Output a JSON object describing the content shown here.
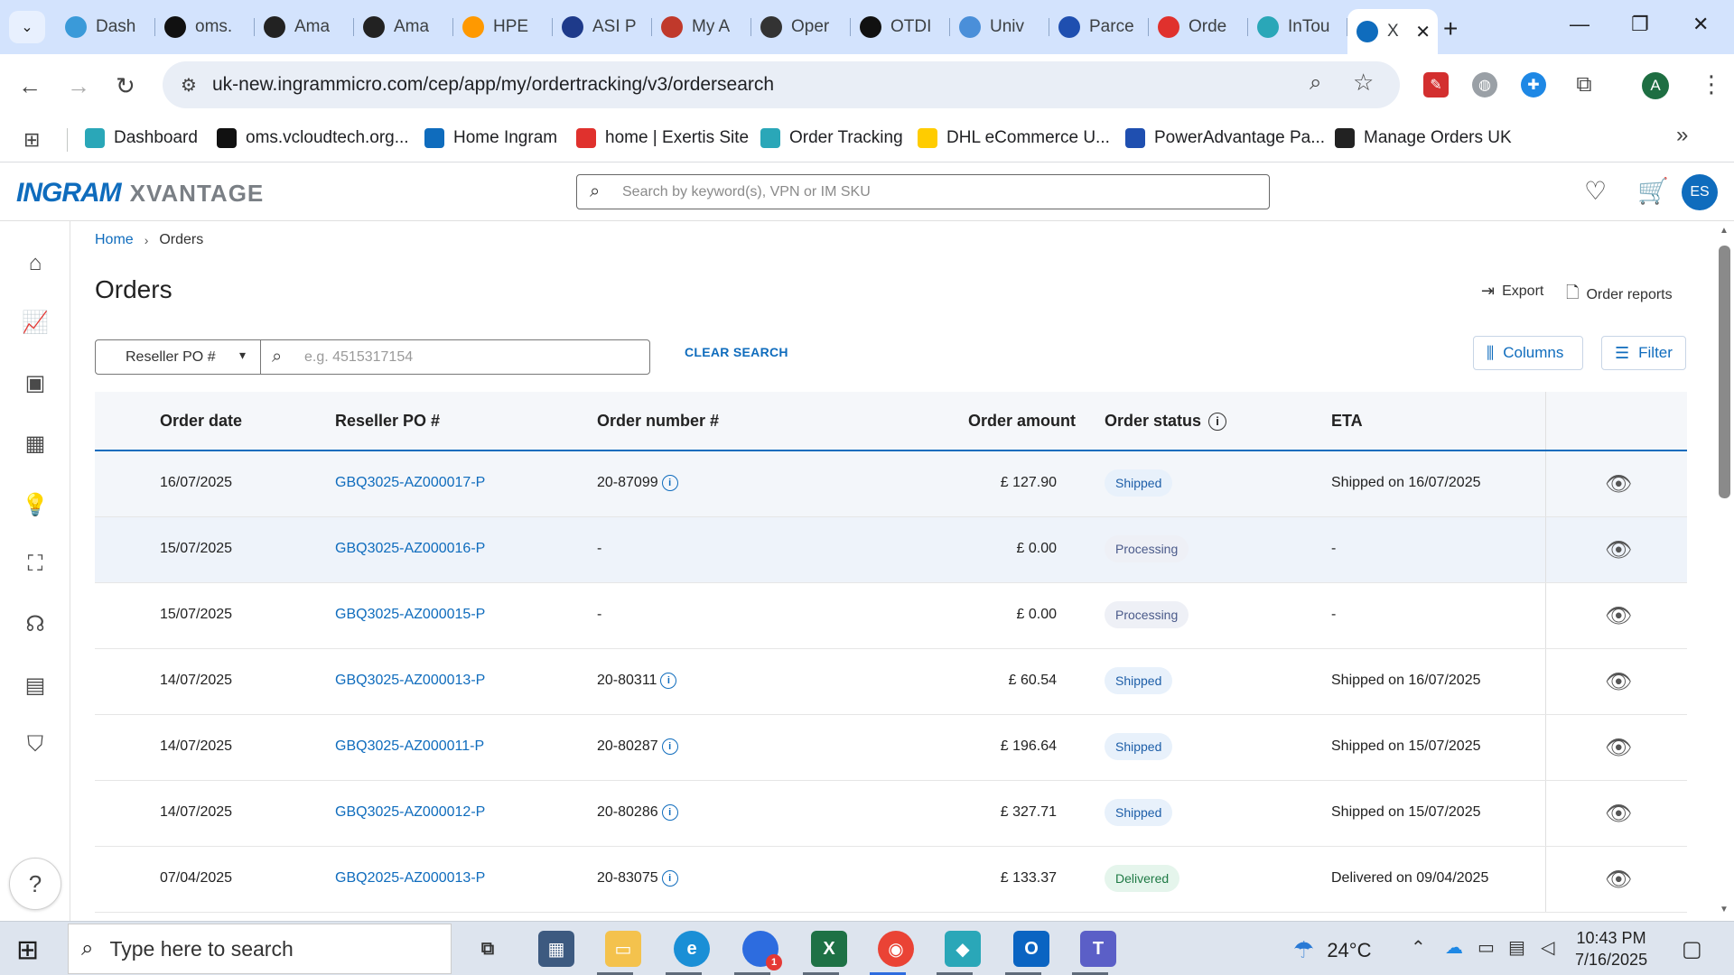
{
  "browser": {
    "tabs": [
      {
        "label": "Dash",
        "icon": "dashboard-icon",
        "color": "#3a9ad9"
      },
      {
        "label": "oms.",
        "icon": "oms-icon",
        "color": "#111111"
      },
      {
        "label": "Ama",
        "icon": "amazon-icon",
        "color": "#222222"
      },
      {
        "label": "Ama",
        "icon": "amazon-icon",
        "color": "#222222"
      },
      {
        "label": "HPE",
        "icon": "amazon-icon",
        "color": "#ff9900"
      },
      {
        "label": "ASI P",
        "icon": "asi-icon",
        "color": "#1e3a8a"
      },
      {
        "label": "My A",
        "icon": "my-account-icon",
        "color": "#c0392b"
      },
      {
        "label": "Oper",
        "icon": "openai-icon",
        "color": "#333333"
      },
      {
        "label": "OTDI",
        "icon": "openai-icon",
        "color": "#111111"
      },
      {
        "label": "Univ",
        "icon": "globe-icon",
        "color": "#4a8fd9"
      },
      {
        "label": "Parce",
        "icon": "parcel-icon",
        "color": "#1f4fb0"
      },
      {
        "label": "Orde",
        "icon": "exertis-icon",
        "color": "#e0312d"
      },
      {
        "label": "InTou",
        "icon": "intouch-icon",
        "color": "#2aa7b8"
      },
      {
        "label": "X",
        "icon": "ingram-icon",
        "color": "#0f6cbd"
      }
    ],
    "url": "uk-new.ingrammicro.com/cep/app/my/ordertracking/v3/ordersearch",
    "profile_initial": "A",
    "bookmarks": [
      {
        "label": "Dashboard",
        "icon": "dashboard-icon",
        "color": "#2aa7b8"
      },
      {
        "label": "oms.vcloudtech.org...",
        "icon": "oms-icon",
        "color": "#111111"
      },
      {
        "label": "Home Ingram",
        "icon": "ingram-icon",
        "color": "#0f6cbd"
      },
      {
        "label": "home | Exertis Site",
        "icon": "exertis-icon",
        "color": "#e0312d"
      },
      {
        "label": "Order Tracking",
        "icon": "intouch-icon",
        "color": "#2aa7b8"
      },
      {
        "label": "DHL eCommerce U...",
        "icon": "dhl-icon",
        "color": "#ffcc00"
      },
      {
        "label": "PowerAdvantage Pa...",
        "icon": "poweradvantage-icon",
        "color": "#1f4fb0"
      },
      {
        "label": "Manage Orders UK",
        "icon": "amazon-icon",
        "color": "#222222"
      }
    ]
  },
  "header": {
    "logo_main": "INGRAM",
    "logo_sub": "XVANTAGE",
    "search_placeholder": "Search by keyword(s), VPN or IM SKU",
    "user_initials": "ES"
  },
  "breadcrumb": {
    "home": "Home",
    "current": "Orders"
  },
  "page": {
    "title": "Orders",
    "export_label": "Export",
    "reports_label": "Order reports",
    "search_type": "Reseller PO #",
    "search_placeholder": "e.g. 4515317154",
    "clear_label": "CLEAR SEARCH",
    "columns_label": "Columns",
    "filter_label": "Filter"
  },
  "table": {
    "headers": {
      "order_date": "Order date",
      "reseller_po": "Reseller PO #",
      "order_number": "Order number #",
      "order_amount": "Order amount",
      "order_status": "Order status",
      "eta": "ETA"
    },
    "rows": [
      {
        "date": "16/07/2025",
        "po": "GBQ3025-AZ000017-P",
        "order": "20-87099",
        "amount": "£ 127.90",
        "status": "Shipped",
        "eta": "Shipped on 16/07/2025"
      },
      {
        "date": "15/07/2025",
        "po": "GBQ3025-AZ000016-P",
        "order": "-",
        "amount": "£ 0.00",
        "status": "Processing",
        "eta": "-"
      },
      {
        "date": "15/07/2025",
        "po": "GBQ3025-AZ000015-P",
        "order": "-",
        "amount": "£ 0.00",
        "status": "Processing",
        "eta": "-"
      },
      {
        "date": "14/07/2025",
        "po": "GBQ3025-AZ000013-P",
        "order": "20-80311",
        "amount": "£ 60.54",
        "status": "Shipped",
        "eta": "Shipped on 16/07/2025"
      },
      {
        "date": "14/07/2025",
        "po": "GBQ3025-AZ000011-P",
        "order": "20-80287",
        "amount": "£ 196.64",
        "status": "Shipped",
        "eta": "Shipped on 15/07/2025"
      },
      {
        "date": "14/07/2025",
        "po": "GBQ3025-AZ000012-P",
        "order": "20-80286",
        "amount": "£ 327.71",
        "status": "Shipped",
        "eta": "Shipped on 15/07/2025"
      },
      {
        "date": "07/04/2025",
        "po": "GBQ2025-AZ000013-P",
        "order": "20-83075",
        "amount": "£ 133.37",
        "status": "Delivered",
        "eta": "Delivered on 09/04/2025"
      }
    ]
  },
  "taskbar": {
    "search_placeholder": "Type here to search",
    "weather": "24°C",
    "time": "10:43 PM",
    "date": "7/16/2025",
    "zoom_badge": "1"
  }
}
